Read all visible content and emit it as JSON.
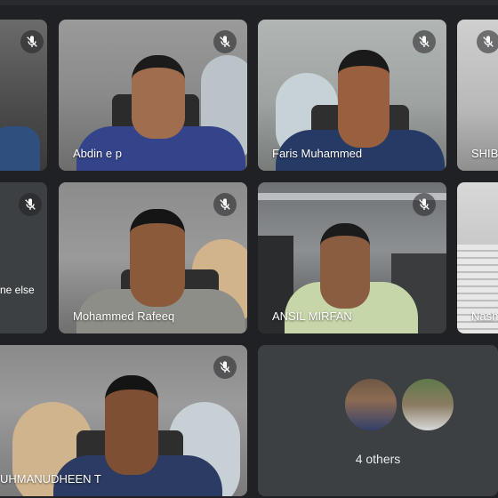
{
  "participants": [
    {
      "id": "p1",
      "name": ""
    },
    {
      "id": "p2",
      "name": "Abdin e p"
    },
    {
      "id": "p3",
      "name": "Faris Muhammed"
    },
    {
      "id": "p4",
      "name": "SHIB"
    },
    {
      "id": "p5",
      "name": "ne else"
    },
    {
      "id": "p6",
      "name": "Mohammed Rafeeq"
    },
    {
      "id": "p7",
      "name": "ANSIL MIRFAN"
    },
    {
      "id": "p8",
      "name": "Nash"
    },
    {
      "id": "p9",
      "name": "UHMANUDHEEN T"
    }
  ],
  "others": {
    "label": "4 others"
  },
  "colors": {
    "background": "#202124",
    "tile": "#3c4043"
  }
}
